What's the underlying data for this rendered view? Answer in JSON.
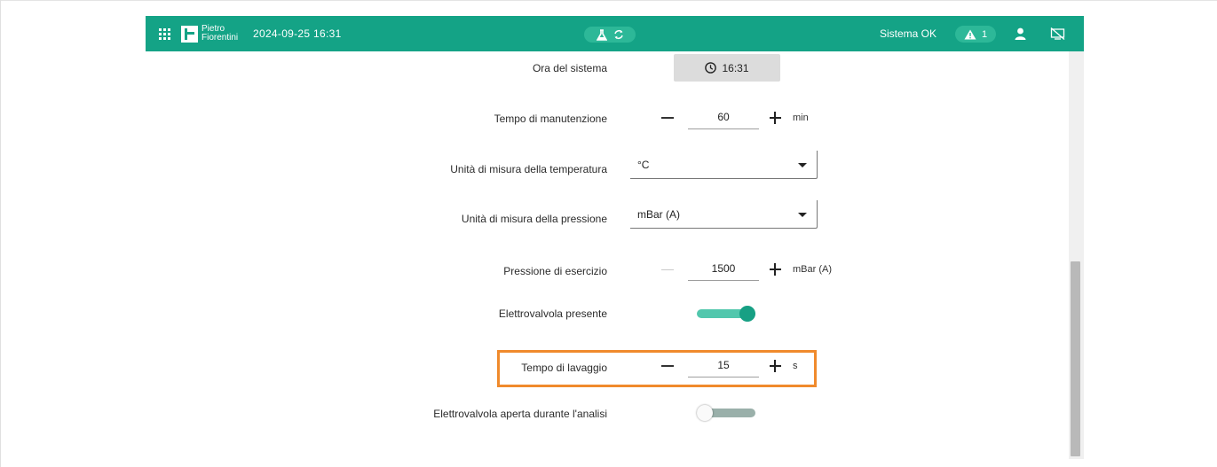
{
  "topbar": {
    "brand_line1": "Pietro",
    "brand_line2": "Fiorentini",
    "datetime": "2024-09-25 16:31",
    "status": "Sistema OK",
    "alarm_count": "1",
    "bar_color": "#14a386"
  },
  "settings": {
    "system_time": {
      "label": "Ora del sistema",
      "value": "16:31"
    },
    "maintenance_time": {
      "label": "Tempo di manutenzione",
      "value": "60",
      "unit": "min"
    },
    "temperature_unit": {
      "label": "Unità di misura della temperatura",
      "value": "°C"
    },
    "pressure_unit": {
      "label": "Unità di misura della pressione",
      "value": "mBar (A)"
    },
    "operating_pressure": {
      "label": "Pressione di esercizio",
      "value": "1500",
      "unit": "mBar (A)"
    },
    "solenoid_present": {
      "label": "Elettrovalvola presente",
      "on": true
    },
    "wash_time": {
      "label": "Tempo di lavaggio",
      "value": "15",
      "unit": "s"
    },
    "solenoid_open_analysis": {
      "label": "Elettrovalvola aperta durante l'analisi",
      "on": false
    }
  },
  "icons": {
    "menu": "grid-icon",
    "logo": "logo-icon",
    "lab": "flask-icon",
    "sync": "sync-icon",
    "alarm": "warning-icon",
    "user": "user-icon",
    "display": "screen-off-icon",
    "clock": "clock-icon"
  },
  "colors": {
    "accent": "#14a386",
    "toggle_on": "#17a084",
    "highlight": "#f08a2c"
  }
}
